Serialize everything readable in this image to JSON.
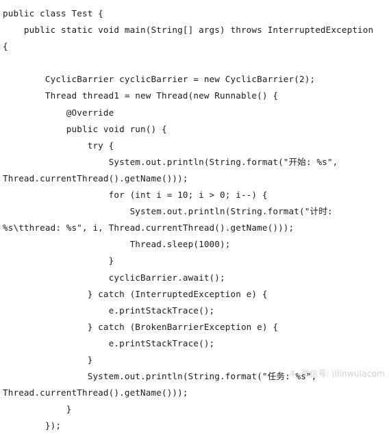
{
  "document": {
    "language": "java",
    "background_color": "#ffffff",
    "text_color": "#1b1b1b",
    "lines": [
      "public class Test {",
      "    public static void main(String[] args) throws InterruptedException",
      "{",
      "",
      "        CyclicBarrier cyclicBarrier = new CyclicBarrier(2);",
      "        Thread thread1 = new Thread(new Runnable() {",
      "            @Override",
      "            public void run() {",
      "                try {",
      "                    System.out.println(String.format(\"开始: %s\",",
      "Thread.currentThread().getName()));",
      "                    for (int i = 10; i > 0; i--) {",
      "                        System.out.println(String.format(\"计时:",
      "%s\\tthread: %s\", i, Thread.currentThread().getName()));",
      "                        Thread.sleep(1000);",
      "                    }",
      "                    cyclicBarrier.await();",
      "                } catch (InterruptedException e) {",
      "                    e.printStackTrace();",
      "                } catch (BrokenBarrierException e) {",
      "                    e.printStackTrace();",
      "                }",
      "                System.out.println(String.format(\"任务: %s\",",
      "Thread.currentThread().getName()));",
      "            }",
      "        });"
    ]
  },
  "watermark": {
    "icon": "wechat-flower-logo-icon",
    "text": "微信号: jilinwulacom",
    "color": "#2b2b2b"
  }
}
